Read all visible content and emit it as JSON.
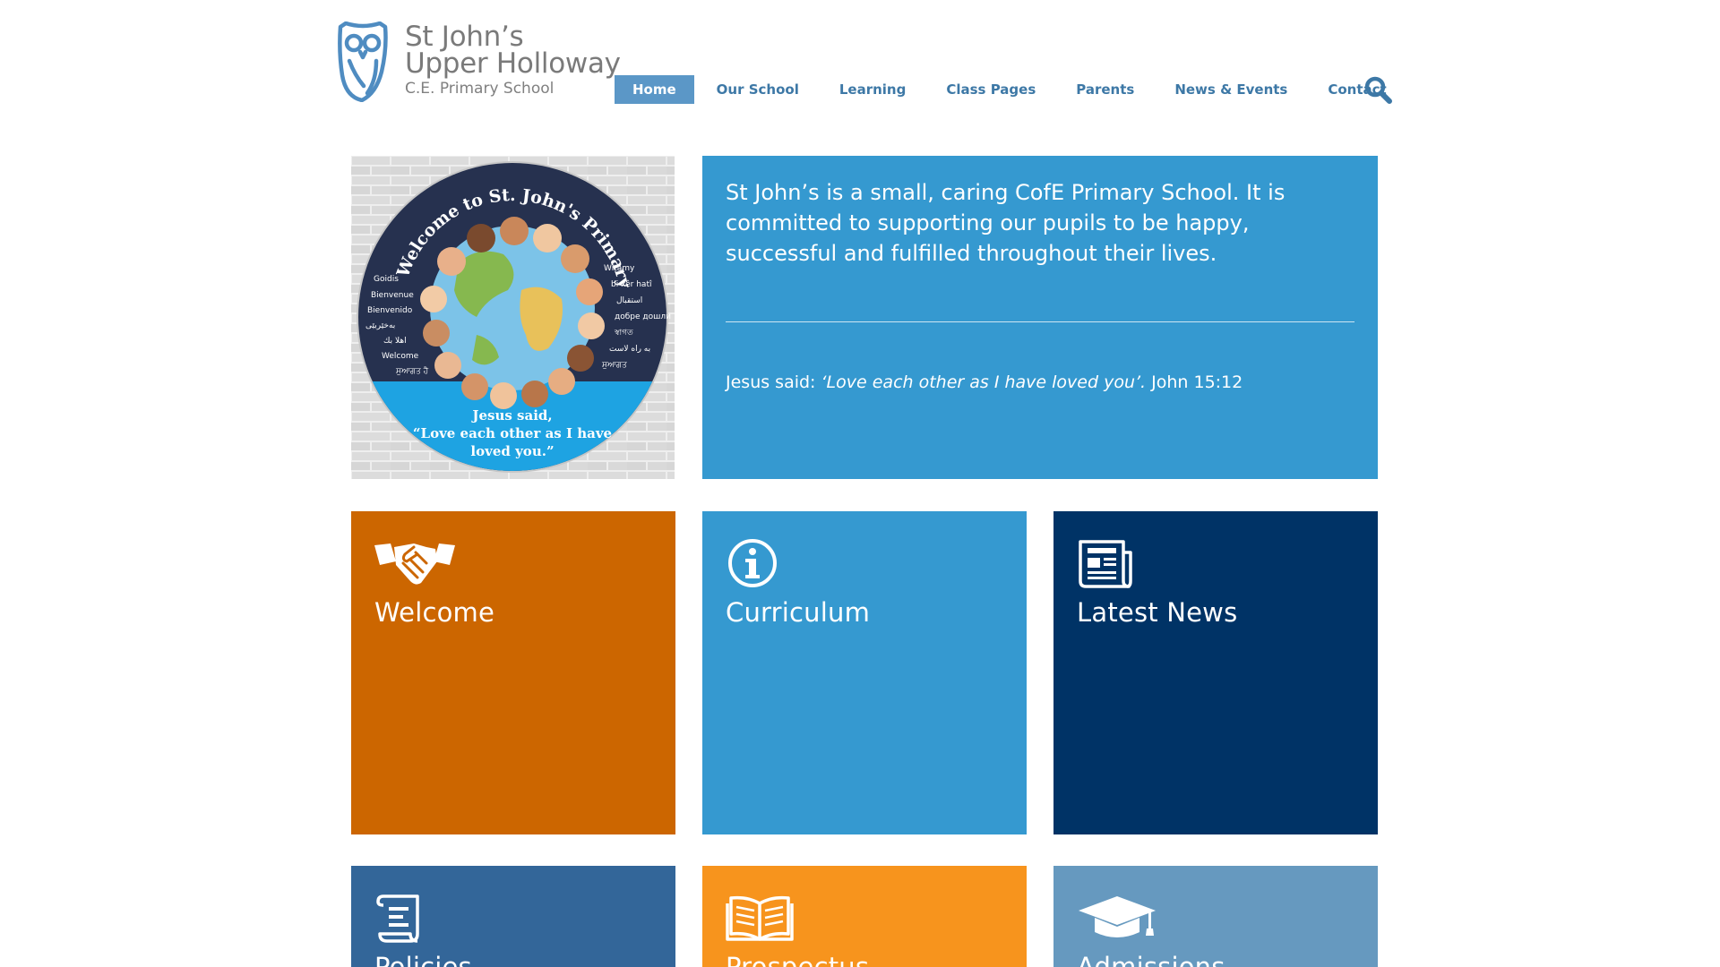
{
  "logo": {
    "line1": "St John’s",
    "line2": "Upper Holloway",
    "line3": "C.E. Primary School"
  },
  "nav": {
    "items": [
      {
        "label": "Home",
        "active": true
      },
      {
        "label": "Our School"
      },
      {
        "label": "Learning"
      },
      {
        "label": "Class Pages"
      },
      {
        "label": "Parents"
      },
      {
        "label": "News & Events"
      },
      {
        "label": "Contact"
      }
    ],
    "search_icon": "search-icon"
  },
  "hero": {
    "image_text": {
      "arc": "Welcome to St. John's Primary",
      "greetings_left": [
        "Goidis",
        "Bienvenue",
        "Bienvenido",
        "بەخێربێی",
        "اهلا بك",
        "Welcome",
        "ਸੁਆਗਤ ਹੈ"
      ],
      "greetings_right": [
        "Witamy",
        "bi xêr hatî",
        "استقبال",
        "добре дошли",
        "স্বাগত",
        "به راه لاست",
        "ਸੁਆਗਤ"
      ],
      "bottom_line1": "Jesus said,",
      "bottom_line2": "“Love each other as I have",
      "bottom_line3": "loved you.”"
    },
    "intro": "St John’s is a small, caring CofE Primary School. It is committed to supporting our pupils to be happy, successful and fulfilled throughout their lives.",
    "quote_prefix": "Jesus said:",
    "quote_text": "‘Love each other as I have loved you’.",
    "quote_ref": "John 15:12"
  },
  "tiles": [
    {
      "title": "Welcome",
      "icon": "handshake-icon",
      "color": "#cc6600"
    },
    {
      "title": "Curriculum",
      "icon": "info-icon",
      "color": "#3599d0"
    },
    {
      "title": "Latest News",
      "icon": "newspaper-icon",
      "color": "#003366"
    },
    {
      "title": "Policies",
      "icon": "document-icon",
      "color": "#336699"
    },
    {
      "title": "Prospectus",
      "icon": "open-book-icon",
      "color": "#f7941d"
    },
    {
      "title": "Admissions",
      "icon": "graduation-cap-icon",
      "color": "#6699bf"
    }
  ],
  "colors": {
    "nav_active_bg": "#5b97c7",
    "nav_text": "#3d78a6",
    "hero_panel_bg": "#3599d0",
    "logo_owl": "#4f8cc1"
  }
}
